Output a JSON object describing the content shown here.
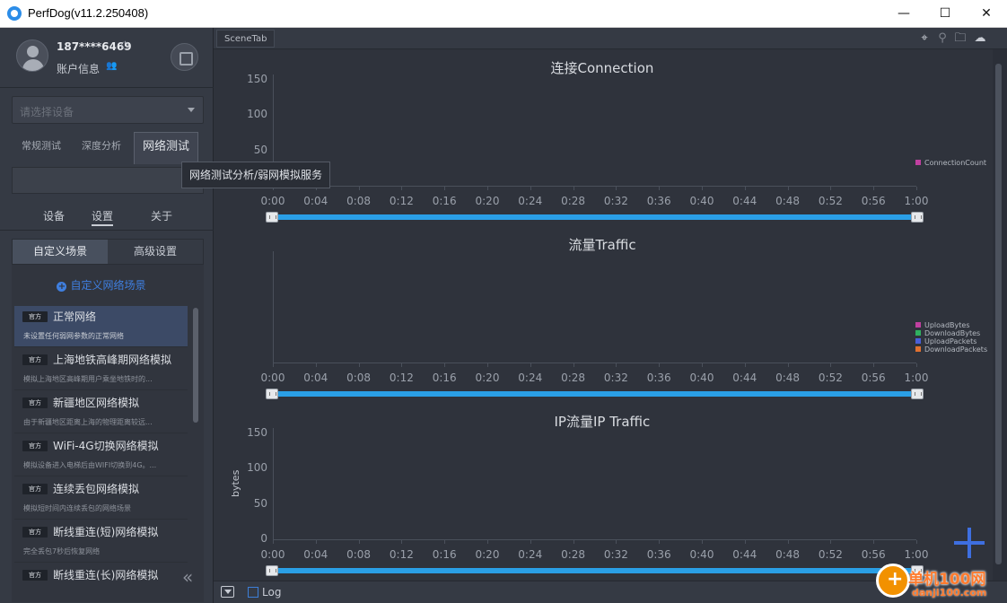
{
  "window": {
    "title": "PerfDog(v11.2.250408)",
    "minimize": "—",
    "maximize": "☐",
    "close": "✕"
  },
  "account": {
    "user_id": "187****6469",
    "power_glyph": "⏻",
    "label": "账户信息",
    "icon_glyph": "👥"
  },
  "device_select": {
    "placeholder": "请选择设备"
  },
  "mode_tabs": [
    "常规测试",
    "深度分析",
    "网络测试"
  ],
  "tooltip": "网络测试分析/弱网模拟服务",
  "sub_tabs": [
    "设备",
    "设置",
    "关于"
  ],
  "scene_tabs": [
    "自定义场景",
    "高级设置"
  ],
  "add_scene": "自定义网络场景",
  "scenes": [
    {
      "badge": "官方",
      "name": "正常网络",
      "desc": "未设置任何弱网参数的正常网络"
    },
    {
      "badge": "官方",
      "name": "上海地铁高峰期网络模拟",
      "desc": "模拟上海地区高峰期用户乘坐地铁时的..."
    },
    {
      "badge": "官方",
      "name": "新疆地区网络模拟",
      "desc": "由于新疆地区距离上海的物理距离较远..."
    },
    {
      "badge": "官方",
      "name": "WiFi-4G切换网络模拟",
      "desc": "模拟设备进入电梯后由WIFI切换到4G。..."
    },
    {
      "badge": "官方",
      "name": "连续丢包网络模拟",
      "desc": "模拟短时间内连续丢包的网络场景"
    },
    {
      "badge": "官方",
      "name": "断线重连(短)网络模拟",
      "desc": "完全丢包7秒后恢复网络"
    },
    {
      "badge": "官方",
      "name": "断线重连(长)网络模拟",
      "desc": ""
    }
  ],
  "collapse_glyph": "«",
  "scene_tab_label": "SceneTab",
  "top_icons": {
    "location": "⌖",
    "pin": "⚲",
    "folder": "🗀",
    "cloud": "☁"
  },
  "x_ticks": [
    "0:00",
    "0:04",
    "0:08",
    "0:12",
    "0:16",
    "0:20",
    "0:24",
    "0:28",
    "0:32",
    "0:36",
    "0:40",
    "0:44",
    "0:48",
    "0:52",
    "0:56",
    "1:00"
  ],
  "chart_data": [
    {
      "type": "line",
      "title": "连接Connection",
      "ylabel": "",
      "ylim": [
        0,
        150
      ],
      "y_ticks": [
        "150",
        "100",
        "50"
      ],
      "series": [
        {
          "name": "ConnectionCount",
          "color": "#c040a0",
          "values": []
        }
      ],
      "legend": "right"
    },
    {
      "type": "line",
      "title": "流量Traffic",
      "ylabel": "",
      "y_ticks": [],
      "series": [
        {
          "name": "UploadBytes",
          "color": "#c040a0",
          "values": []
        },
        {
          "name": "DownloadBytes",
          "color": "#30b060",
          "values": []
        },
        {
          "name": "UploadPackets",
          "color": "#4a5fd8",
          "values": []
        },
        {
          "name": "DownloadPackets",
          "color": "#e07030",
          "values": []
        }
      ],
      "legend": "right"
    },
    {
      "type": "line",
      "title": "IP流量IP Traffic",
      "ylabel": "bytes",
      "ylim": [
        0,
        150
      ],
      "y_ticks": [
        "150",
        "100",
        "50",
        "0"
      ],
      "series": [],
      "legend": "none"
    }
  ],
  "log_label": "Log",
  "watermark": {
    "name": "单机100网",
    "url": "danji100.com"
  }
}
